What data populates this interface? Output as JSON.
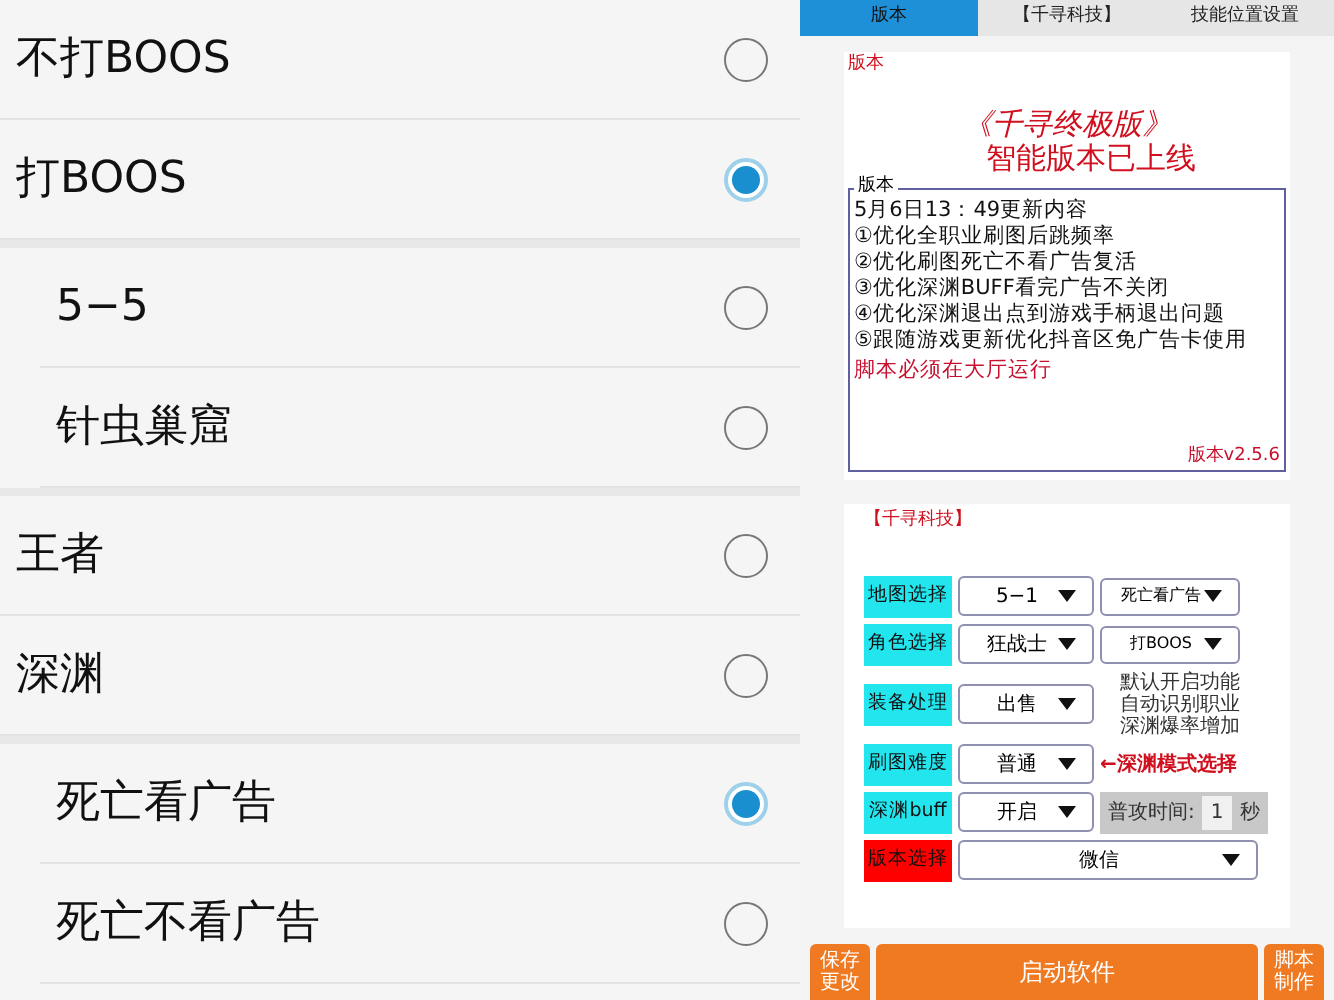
{
  "option_groups": [
    {
      "options": [
        {
          "label": "不打BOOS",
          "selected": false
        },
        {
          "label": "打BOOS",
          "selected": true
        }
      ]
    },
    {
      "options": [
        {
          "label": "5−5",
          "selected": false
        },
        {
          "label": "针虫巢窟",
          "selected": false
        }
      ]
    },
    {
      "options": [
        {
          "label": "王者",
          "selected": false
        },
        {
          "label": "深渊",
          "selected": false
        }
      ]
    },
    {
      "options": [
        {
          "label": "死亡看广告",
          "selected": true
        },
        {
          "label": "死亡不看广告",
          "selected": false
        }
      ]
    }
  ],
  "tabs": [
    {
      "label": "版本",
      "selected": true
    },
    {
      "label": "【千寻科技】",
      "selected": false
    },
    {
      "label": "技能位置设置",
      "selected": false
    }
  ],
  "version_card": {
    "title": "版本",
    "headline": [
      "《千寻终极版》",
      "智能版本已上线"
    ],
    "box_title": "版本",
    "lines": [
      "5月6日13：49更新内容",
      "①优化全职业刷图后跳频率",
      "②优化刷图死亡不看广告复活",
      "③优化深渊BUFF看完广告不关闭",
      "④优化深渊退出点到游戏手柄退出问题",
      "⑤跟随游戏更新优化抖音区免广告卡使用"
    ],
    "notice": "脚本必须在大厅运行",
    "version": "版本v2.5.6"
  },
  "settings_card": {
    "title": "【千寻科技】",
    "rows": [
      {
        "label": "地图选择",
        "color": "#22e5ee",
        "value": "5−1",
        "extra": {
          "kind": "dropdown",
          "value": "死亡看广告"
        }
      },
      {
        "label": "角色选择",
        "color": "#22e5ee",
        "value": "狂战士",
        "extra": {
          "kind": "dropdown",
          "value": "打BOOS"
        }
      },
      {
        "label": "装备处理",
        "color": "#22e5ee",
        "value": "出售",
        "extra": {
          "kind": "note",
          "lines": [
            "默认开启功能",
            "自动识别职业",
            "深渊爆率增加"
          ]
        }
      },
      {
        "label": "刷图难度",
        "color": "#22e5ee",
        "value": "普通",
        "extra": {
          "kind": "hint",
          "text": "←深渊模式选择"
        }
      },
      {
        "label": "深渊buff",
        "color": "#22e5ee",
        "value": "开启",
        "extra": {
          "kind": "timer",
          "label": "普攻时间:",
          "value": "1",
          "unit": "秒"
        }
      },
      {
        "label": "版本选择",
        "color": "#ff0000",
        "value": "微信"
      }
    ]
  },
  "bottom_buttons": [
    {
      "label": "保存更改"
    },
    {
      "label": "启动软件"
    },
    {
      "label": "脚本制作"
    }
  ]
}
